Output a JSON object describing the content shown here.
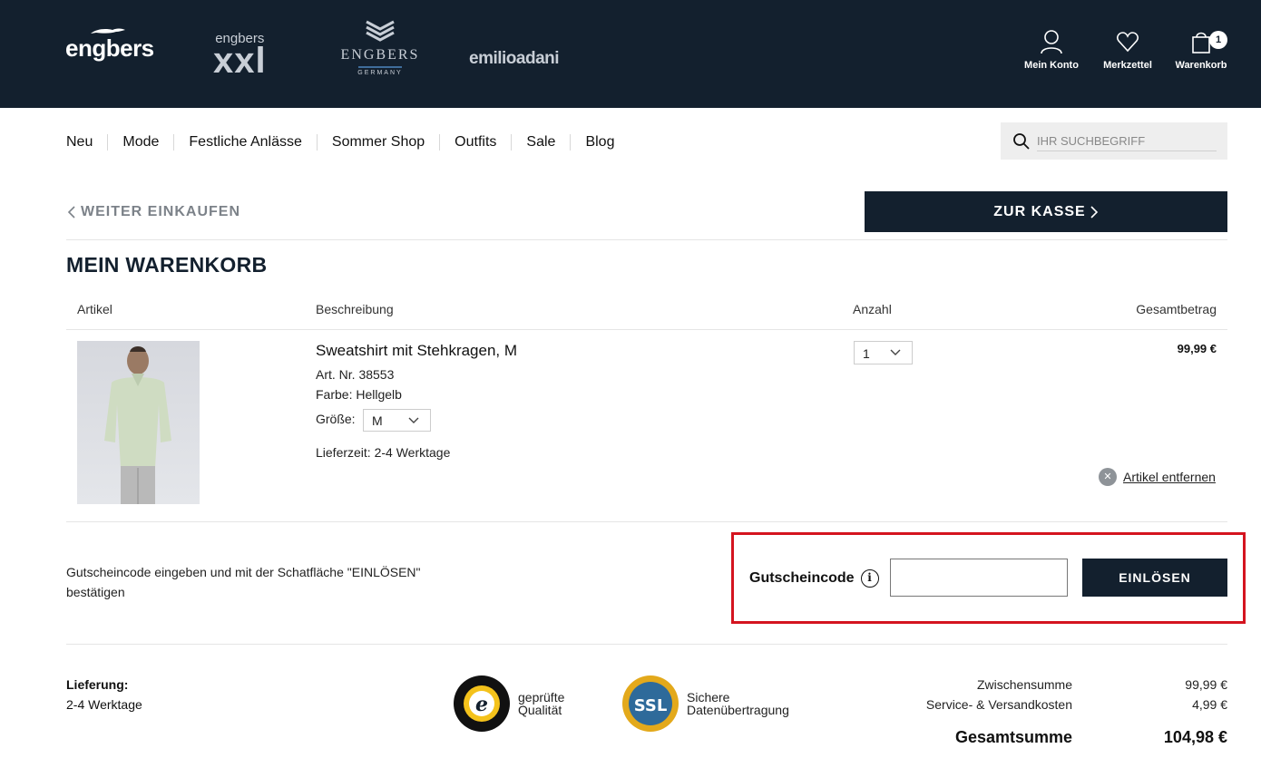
{
  "header": {
    "brands": {
      "engbers": "engbers",
      "xxl_small": "engbers",
      "xxl_big": "xxl",
      "germany_big": "ENGBERS",
      "germany_small": "GERMANY",
      "emilio": "emilioadani"
    },
    "account_label": "Mein Konto",
    "wishlist_label": "Merkzettel",
    "cart_label": "Warenkorb",
    "cart_count": "1",
    "background_color": "#13202e"
  },
  "nav": {
    "items": [
      "Neu",
      "Mode",
      "Festliche Anlässe",
      "Sommer Shop",
      "Outfits",
      "Sale",
      "Blog"
    ]
  },
  "search": {
    "placeholder": "IHR SUCHBEGRIFF",
    "icon": "search-icon"
  },
  "actions": {
    "continue_label": "WEITER EINKAUFEN",
    "checkout_label": "ZUR KASSE"
  },
  "cart": {
    "title": "MEIN WARENKORB",
    "columns": {
      "article": "Artikel",
      "description": "Beschreibung",
      "quantity": "Anzahl",
      "total": "Gesamtbetrag"
    },
    "item": {
      "name": "Sweatshirt mit Stehkragen, M",
      "sku": "Art. Nr. 38553",
      "color": "Farbe: Hellgelb",
      "size_label": "Größe:",
      "size_value": "M",
      "delivery": "Lieferzeit: 2-4 Werktage",
      "quantity": "1",
      "total": "99,99 €",
      "remove_label": "Artikel entfernen"
    }
  },
  "voucher": {
    "hint": "Gutscheincode eingeben und mit der Schatfläche \"EINLÖSEN\" bestätigen",
    "label": "Gutscheincode",
    "info_glyph": "i",
    "input_value": "",
    "redeem_label": "EINLÖSEN",
    "highlight_color": "#d4141f"
  },
  "footer": {
    "delivery_title": "Lieferung:",
    "delivery_text": "2-4 Werktage",
    "trusted_line1": "geprüfte",
    "trusted_line2": "Qualität",
    "ssl_line1": "Sichere",
    "ssl_line2": "Datenübertragung",
    "subtotal_label": "Zwischensumme",
    "subtotal_value": "99,99 €",
    "shipping_label": "Service- & Versandkosten",
    "shipping_value": "4,99 €",
    "grand_total_label": "Gesamtsumme",
    "grand_total_value": "104,98 €"
  }
}
